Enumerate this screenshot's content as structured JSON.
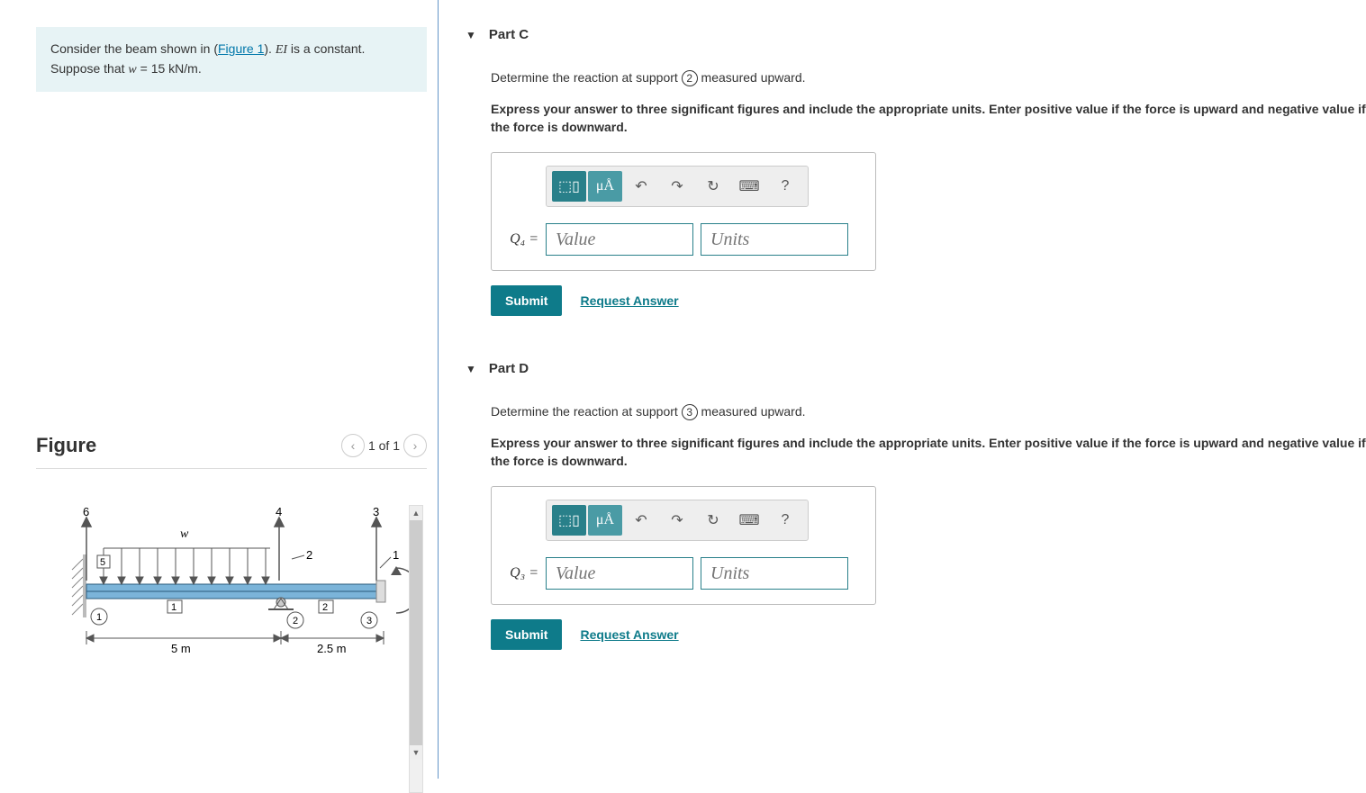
{
  "problem": {
    "text1": "Consider the beam shown in (",
    "figureLink": "Figure 1",
    "text2": "). ",
    "ei": "EI",
    "text3": " is a constant. Suppose that ",
    "w": "w",
    "text4": " = 15 ",
    "unit": "kN/m",
    "text5": "."
  },
  "figure": {
    "title": "Figure",
    "pager": "1 of 1",
    "labels": {
      "w": "w",
      "n1": "1",
      "n2": "2",
      "n3": "3",
      "n4": "4",
      "n5": "5",
      "n6": "6",
      "c1": "1",
      "c2": "2",
      "c3": "3",
      "d1": "5 m",
      "d2": "2.5 m"
    }
  },
  "parts": {
    "c": {
      "title": "Part C",
      "prompt1": "Determine the reaction at support ",
      "support": "2",
      "prompt2": " measured upward.",
      "hint": "Express your answer to three significant figures and include the appropriate units. Enter positive value if the force is upward and negative value if the force is downward.",
      "varLabel": "Q₄ =",
      "valuePlaceholder": "Value",
      "unitsPlaceholder": "Units",
      "submit": "Submit",
      "request": "Request Answer"
    },
    "d": {
      "title": "Part D",
      "prompt1": "Determine the reaction at support ",
      "support": "3",
      "prompt2": " measured upward.",
      "hint": "Express your answer to three significant figures and include the appropriate units. Enter positive value if the force is upward and negative value if the force is downward.",
      "varLabel": "Q₃ =",
      "valuePlaceholder": "Value",
      "unitsPlaceholder": "Units",
      "submit": "Submit",
      "request": "Request Answer"
    }
  },
  "toolbar": {
    "templates": "⬚▯",
    "greek": "μÅ",
    "undo": "↶",
    "redo": "↷",
    "reset": "↻",
    "keyboard": "⌨",
    "help": "?"
  }
}
